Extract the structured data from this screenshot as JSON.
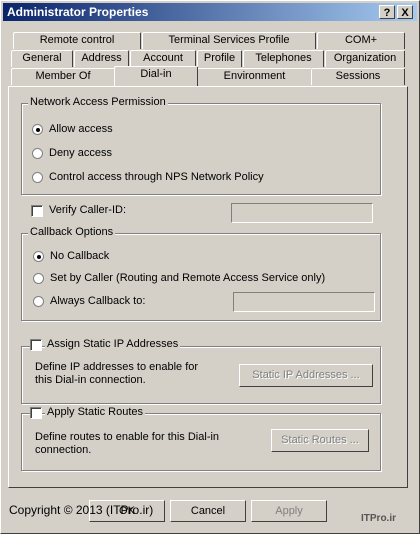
{
  "window": {
    "title": "Administrator Properties",
    "help_button": "?",
    "close_button": "X"
  },
  "tabs": {
    "row1": [
      "Remote control",
      "Terminal Services Profile",
      "COM+"
    ],
    "row2": [
      "General",
      "Address",
      "Account",
      "Profile",
      "Telephones",
      "Organization"
    ],
    "row3": [
      "Member Of",
      "Dial-in",
      "Environment",
      "Sessions"
    ],
    "active": "Dial-in"
  },
  "network_access": {
    "title": "Network Access Permission",
    "options": [
      "Allow access",
      "Deny access",
      "Control access through NPS Network Policy"
    ],
    "selected": "Allow access"
  },
  "verify_caller": {
    "label": "Verify Caller-ID:",
    "checked": false,
    "value": ""
  },
  "callback": {
    "title": "Callback Options",
    "options": [
      "No Callback",
      "Set by Caller (Routing and Remote Access Service only)",
      "Always Callback to:"
    ],
    "selected": "No Callback",
    "value": ""
  },
  "static_ip": {
    "label": "Assign Static IP Addresses",
    "checked": false,
    "description": "Define IP addresses to enable for this Dial-in connection.",
    "button": "Static IP Addresses ..."
  },
  "static_routes": {
    "label": "Apply Static Routes",
    "checked": false,
    "description": "Define routes to enable for this Dial-in connection.",
    "button": "Static Routes ..."
  },
  "footer": {
    "overlay_text": "Copyright © 2013 (ITPro.ir)",
    "overlay_text2": "ITPro.ir",
    "ok_partial": "OK",
    "cancel_partial": "Cancel",
    "apply_partial": "Apply"
  }
}
